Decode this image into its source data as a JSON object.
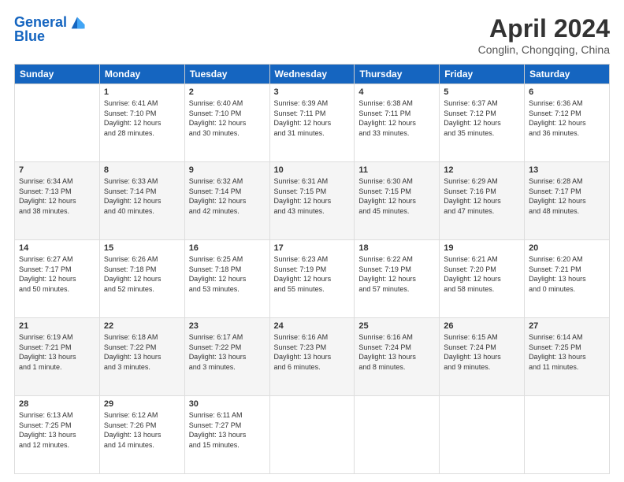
{
  "header": {
    "logo_line1": "General",
    "logo_line2": "Blue",
    "month_year": "April 2024",
    "location": "Conglin, Chongqing, China"
  },
  "weekdays": [
    "Sunday",
    "Monday",
    "Tuesday",
    "Wednesday",
    "Thursday",
    "Friday",
    "Saturday"
  ],
  "weeks": [
    [
      {
        "day": "",
        "info": ""
      },
      {
        "day": "1",
        "info": "Sunrise: 6:41 AM\nSunset: 7:10 PM\nDaylight: 12 hours\nand 28 minutes."
      },
      {
        "day": "2",
        "info": "Sunrise: 6:40 AM\nSunset: 7:10 PM\nDaylight: 12 hours\nand 30 minutes."
      },
      {
        "day": "3",
        "info": "Sunrise: 6:39 AM\nSunset: 7:11 PM\nDaylight: 12 hours\nand 31 minutes."
      },
      {
        "day": "4",
        "info": "Sunrise: 6:38 AM\nSunset: 7:11 PM\nDaylight: 12 hours\nand 33 minutes."
      },
      {
        "day": "5",
        "info": "Sunrise: 6:37 AM\nSunset: 7:12 PM\nDaylight: 12 hours\nand 35 minutes."
      },
      {
        "day": "6",
        "info": "Sunrise: 6:36 AM\nSunset: 7:12 PM\nDaylight: 12 hours\nand 36 minutes."
      }
    ],
    [
      {
        "day": "7",
        "info": "Sunrise: 6:34 AM\nSunset: 7:13 PM\nDaylight: 12 hours\nand 38 minutes."
      },
      {
        "day": "8",
        "info": "Sunrise: 6:33 AM\nSunset: 7:14 PM\nDaylight: 12 hours\nand 40 minutes."
      },
      {
        "day": "9",
        "info": "Sunrise: 6:32 AM\nSunset: 7:14 PM\nDaylight: 12 hours\nand 42 minutes."
      },
      {
        "day": "10",
        "info": "Sunrise: 6:31 AM\nSunset: 7:15 PM\nDaylight: 12 hours\nand 43 minutes."
      },
      {
        "day": "11",
        "info": "Sunrise: 6:30 AM\nSunset: 7:15 PM\nDaylight: 12 hours\nand 45 minutes."
      },
      {
        "day": "12",
        "info": "Sunrise: 6:29 AM\nSunset: 7:16 PM\nDaylight: 12 hours\nand 47 minutes."
      },
      {
        "day": "13",
        "info": "Sunrise: 6:28 AM\nSunset: 7:17 PM\nDaylight: 12 hours\nand 48 minutes."
      }
    ],
    [
      {
        "day": "14",
        "info": "Sunrise: 6:27 AM\nSunset: 7:17 PM\nDaylight: 12 hours\nand 50 minutes."
      },
      {
        "day": "15",
        "info": "Sunrise: 6:26 AM\nSunset: 7:18 PM\nDaylight: 12 hours\nand 52 minutes."
      },
      {
        "day": "16",
        "info": "Sunrise: 6:25 AM\nSunset: 7:18 PM\nDaylight: 12 hours\nand 53 minutes."
      },
      {
        "day": "17",
        "info": "Sunrise: 6:23 AM\nSunset: 7:19 PM\nDaylight: 12 hours\nand 55 minutes."
      },
      {
        "day": "18",
        "info": "Sunrise: 6:22 AM\nSunset: 7:19 PM\nDaylight: 12 hours\nand 57 minutes."
      },
      {
        "day": "19",
        "info": "Sunrise: 6:21 AM\nSunset: 7:20 PM\nDaylight: 12 hours\nand 58 minutes."
      },
      {
        "day": "20",
        "info": "Sunrise: 6:20 AM\nSunset: 7:21 PM\nDaylight: 13 hours\nand 0 minutes."
      }
    ],
    [
      {
        "day": "21",
        "info": "Sunrise: 6:19 AM\nSunset: 7:21 PM\nDaylight: 13 hours\nand 1 minute."
      },
      {
        "day": "22",
        "info": "Sunrise: 6:18 AM\nSunset: 7:22 PM\nDaylight: 13 hours\nand 3 minutes."
      },
      {
        "day": "23",
        "info": "Sunrise: 6:17 AM\nSunset: 7:22 PM\nDaylight: 13 hours\nand 3 minutes."
      },
      {
        "day": "24",
        "info": "Sunrise: 6:16 AM\nSunset: 7:23 PM\nDaylight: 13 hours\nand 6 minutes."
      },
      {
        "day": "25",
        "info": "Sunrise: 6:16 AM\nSunset: 7:24 PM\nDaylight: 13 hours\nand 8 minutes."
      },
      {
        "day": "26",
        "info": "Sunrise: 6:15 AM\nSunset: 7:24 PM\nDaylight: 13 hours\nand 9 minutes."
      },
      {
        "day": "27",
        "info": "Sunrise: 6:14 AM\nSunset: 7:25 PM\nDaylight: 13 hours\nand 11 minutes."
      }
    ],
    [
      {
        "day": "28",
        "info": "Sunrise: 6:13 AM\nSunset: 7:25 PM\nDaylight: 13 hours\nand 12 minutes."
      },
      {
        "day": "29",
        "info": "Sunrise: 6:12 AM\nSunset: 7:26 PM\nDaylight: 13 hours\nand 14 minutes."
      },
      {
        "day": "30",
        "info": "Sunrise: 6:11 AM\nSunset: 7:27 PM\nDaylight: 13 hours\nand 15 minutes."
      },
      {
        "day": "",
        "info": ""
      },
      {
        "day": "",
        "info": ""
      },
      {
        "day": "",
        "info": ""
      },
      {
        "day": "",
        "info": ""
      }
    ]
  ]
}
